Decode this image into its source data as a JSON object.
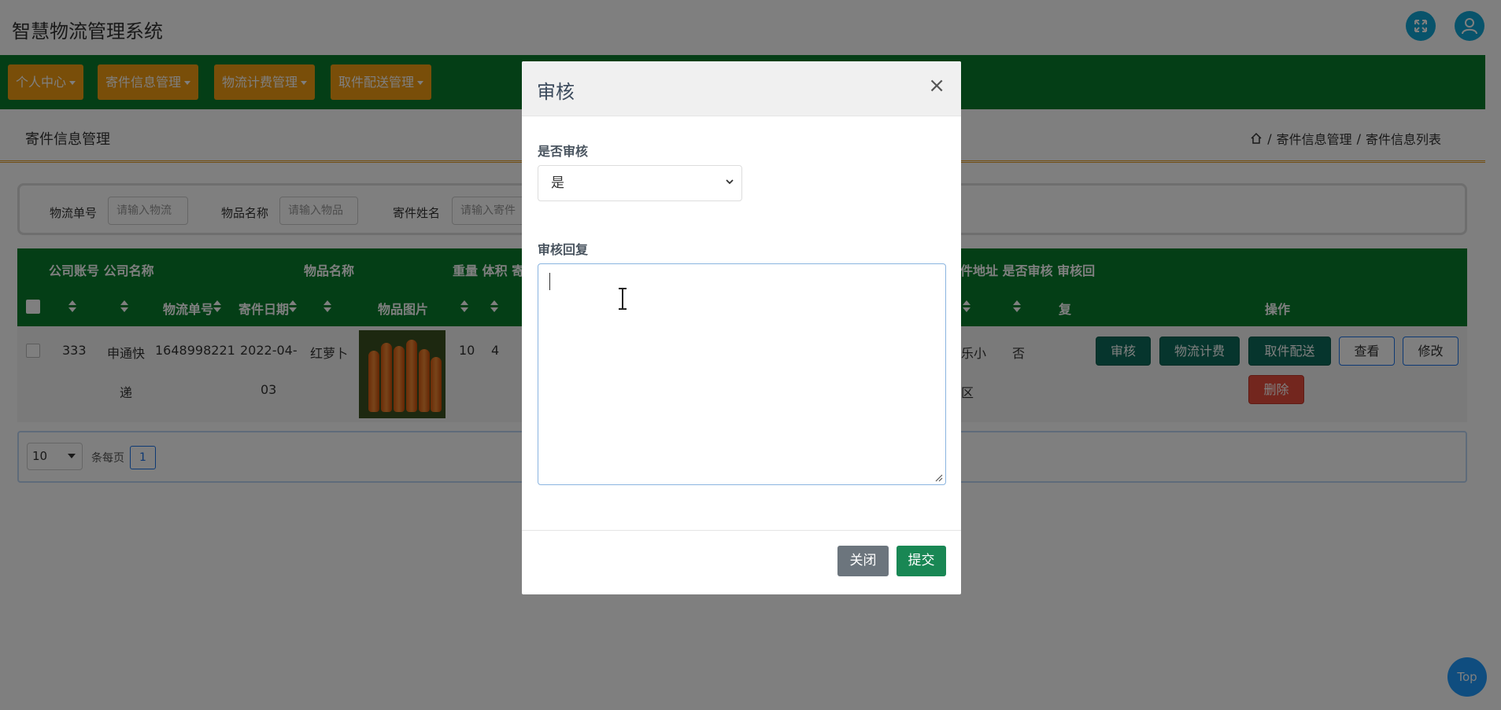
{
  "header": {
    "title": "智慧物流管理系统",
    "fullscreen_icon": "fullscreen-icon",
    "user_icon": "user-icon"
  },
  "nav": {
    "items": [
      {
        "label": "个人中心"
      },
      {
        "label": "寄件信息管理"
      },
      {
        "label": "物流计费管理"
      },
      {
        "label": "取件配送管理"
      }
    ]
  },
  "page": {
    "title": "寄件信息管理",
    "breadcrumb": {
      "home_icon": "home-icon",
      "items": [
        "寄件信息管理",
        "寄件信息列表"
      ],
      "separator": "/"
    }
  },
  "search": {
    "fields": [
      {
        "label": "物流单号",
        "placeholder": "请输入物流"
      },
      {
        "label": "物品名称",
        "placeholder": "请输入物品"
      },
      {
        "label": "寄件姓名",
        "placeholder": "请输入寄件"
      }
    ]
  },
  "table": {
    "group_headers": [
      "公司账号 公司名称",
      "物品名称",
      "重量 体积 寄",
      "件地址 是否审核 审核回"
    ],
    "col_headers": {
      "tracking": "物流单号",
      "date": "寄件日期",
      "image": "物品图片",
      "reply_end": "复",
      "ops": "操作"
    },
    "row": {
      "account": "333",
      "company_line1": "申通快",
      "company_line2": "递",
      "tracking": "1648998221",
      "date_line1": "2022-04-",
      "date_line2": "03",
      "item": "红萝卜",
      "weight": "10",
      "volume": "4",
      "address_line1": "乐小",
      "address_line2": "区",
      "audited": "否"
    },
    "ops": {
      "audit": "审核",
      "billing": "物流计费",
      "delivery": "取件配送",
      "view": "查看",
      "edit": "修改",
      "delete": "删除"
    }
  },
  "pager": {
    "page_size": "10",
    "per_page_label": "条每页",
    "current_page": "1"
  },
  "top_button": "Top",
  "modal": {
    "title": "审核",
    "close_symbol": "×",
    "audit_label": "是否审核",
    "audit_value": "是",
    "reply_label": "审核回复",
    "reply_value": "",
    "close_button": "关闭",
    "submit_button": "提交"
  },
  "colors": {
    "nav_green": "#087d2d",
    "nav_button_orange": "#f39c12",
    "op_teal": "#0d6b5a",
    "delete_red": "#e74c3c",
    "submit_green": "#198754",
    "close_gray": "#6c757d",
    "accent_blue": "#1e9bff"
  }
}
